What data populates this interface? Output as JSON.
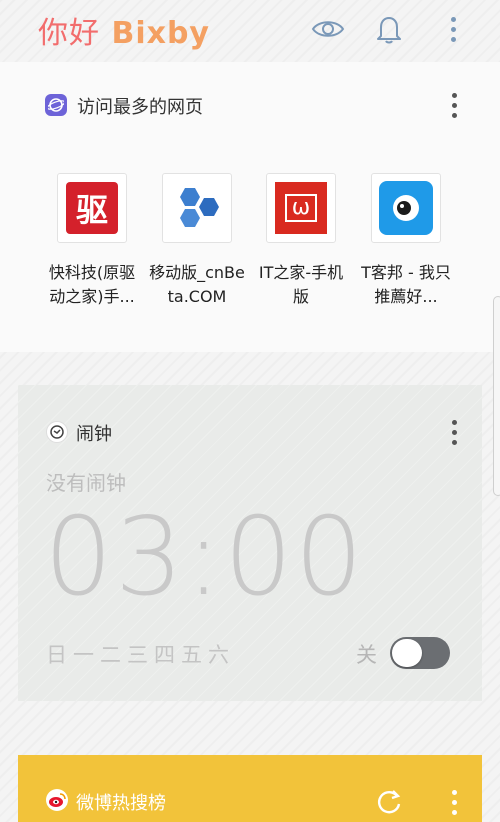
{
  "header": {
    "brand_cn": "你好",
    "brand_en": "Bixby"
  },
  "most_visited": {
    "title": "访问最多的网页",
    "apps": [
      {
        "label": "快科技(原驱动之家)手...",
        "icon_text": "驱",
        "icon": "drive-home-icon"
      },
      {
        "label": "移动版_cnBeta.COM",
        "icon": "cnbeta-hexagon-icon"
      },
      {
        "label": "IT之家-手机版",
        "icon_text": "ω",
        "icon": "ithome-icon"
      },
      {
        "label": "T客邦 - 我只推薦好...",
        "icon": "tkebang-eye-icon"
      }
    ]
  },
  "alarm": {
    "title": "闹钟",
    "status": "没有闹钟",
    "time": "03:00",
    "days": "日一二三四五六",
    "toggle_label": "关",
    "toggle_on": false
  },
  "weibo": {
    "title": "微博热搜榜"
  },
  "colors": {
    "brand_cn": "#f26d6d",
    "brand_en": "#f4a062",
    "weibo_card": "#f2c33a",
    "toggle_track": "#6b6e72"
  }
}
